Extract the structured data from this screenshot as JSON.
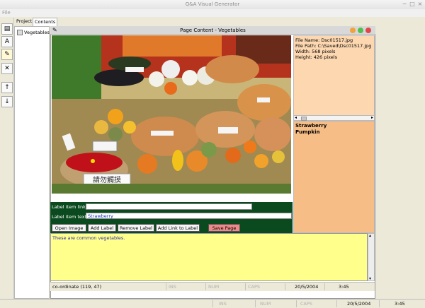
{
  "app": {
    "title": "Q&A Visual Generator"
  },
  "menu": {
    "file": "File"
  },
  "tabs": {
    "project": "Project",
    "contents": "Contents"
  },
  "tree": {
    "items": [
      "Vegetables"
    ]
  },
  "toolbar_icons": [
    "new-page-icon",
    "text-icon",
    "pencil-icon",
    "delete-icon",
    "move-up-icon",
    "move-down-icon"
  ],
  "page_window": {
    "title": "Page Content - Vegetables"
  },
  "file_info": {
    "name": "File Name: Dsc01517.jpg",
    "path": "File Path: C:\\Saved\\Dsc01517.jpg",
    "width": "Width: 568 pixels",
    "height": "Height: 426 pixels"
  },
  "labels_list": [
    "Strawberry",
    "Pumpkin"
  ],
  "form": {
    "link_label": "Label item link :",
    "link_value": "",
    "text_label": "Label item text",
    "text_value": "Strawberry"
  },
  "buttons": {
    "open_image": "Open Image",
    "add_label": "Add Label",
    "remove_label": "Remove Label",
    "add_link": "Add Link to Label",
    "save_page": "Save Page"
  },
  "description": "These are common vegetables.",
  "photo_signage": "請勿觸摸",
  "inner_status": {
    "coordinate": "co-ordinate (119, 47)",
    "ins": "INS",
    "num": "NUM",
    "caps": "CAPS",
    "date": "20/5/2004",
    "time": "3:45"
  },
  "outer_status": {
    "ins": "INS",
    "num": "NUM",
    "caps": "CAPS",
    "date": "20/5/2004",
    "time": "3:45"
  },
  "colors": {
    "info_panel": "#fcd7b0",
    "list_panel": "#f6be86",
    "description_bg": "#ffff8c",
    "form_bg": "#0a4a1e",
    "save_button": "#f08a8a"
  }
}
